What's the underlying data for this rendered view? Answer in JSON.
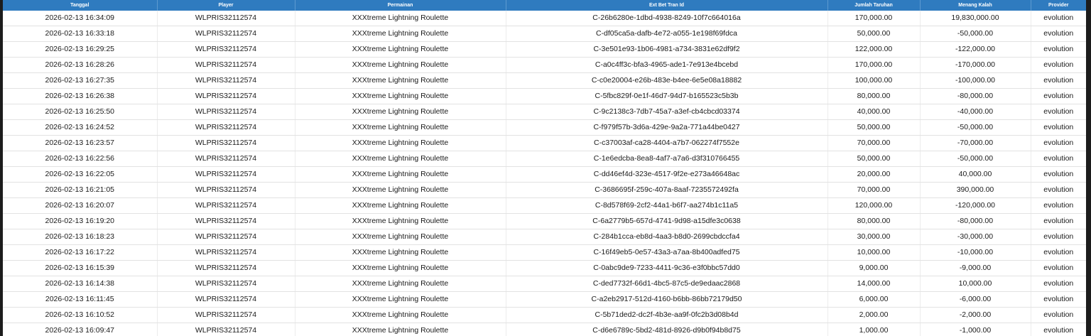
{
  "table": {
    "columns": [
      "Tanggal",
      "Player",
      "Permainan",
      "Ext Bet Tran Id",
      "Jumlah Taruhan",
      "Menang Kalah",
      "Provider"
    ],
    "rows": [
      [
        "2026-02-13 16:34:09",
        "WLPRIS32112574",
        "XXXtreme Lightning Roulette",
        "C-26b6280e-1dbd-4938-8249-10f7c664016a",
        "170,000.00",
        "19,830,000.00",
        "evolution"
      ],
      [
        "2026-02-13 16:33:18",
        "WLPRIS32112574",
        "XXXtreme Lightning Roulette",
        "C-df05ca5a-dafb-4e72-a055-1e198f69fdca",
        "50,000.00",
        "-50,000.00",
        "evolution"
      ],
      [
        "2026-02-13 16:29:25",
        "WLPRIS32112574",
        "XXXtreme Lightning Roulette",
        "C-3e501e93-1b06-4981-a734-3831e62df9f2",
        "122,000.00",
        "-122,000.00",
        "evolution"
      ],
      [
        "2026-02-13 16:28:26",
        "WLPRIS32112574",
        "XXXtreme Lightning Roulette",
        "C-a0c4ff3c-bfa3-4965-ade1-7e913e4bcebd",
        "170,000.00",
        "-170,000.00",
        "evolution"
      ],
      [
        "2026-02-13 16:27:35",
        "WLPRIS32112574",
        "XXXtreme Lightning Roulette",
        "C-c0e20004-e26b-483e-b4ee-6e5e08a18882",
        "100,000.00",
        "-100,000.00",
        "evolution"
      ],
      [
        "2026-02-13 16:26:38",
        "WLPRIS32112574",
        "XXXtreme Lightning Roulette",
        "C-5fbc829f-0e1f-46d7-94d7-b165523c5b3b",
        "80,000.00",
        "-80,000.00",
        "evolution"
      ],
      [
        "2026-02-13 16:25:50",
        "WLPRIS32112574",
        "XXXtreme Lightning Roulette",
        "C-9c2138c3-7db7-45a7-a3ef-cb4cbcd03374",
        "40,000.00",
        "-40,000.00",
        "evolution"
      ],
      [
        "2026-02-13 16:24:52",
        "WLPRIS32112574",
        "XXXtreme Lightning Roulette",
        "C-f979f57b-3d6a-429e-9a2a-771a44be0427",
        "50,000.00",
        "-50,000.00",
        "evolution"
      ],
      [
        "2026-02-13 16:23:57",
        "WLPRIS32112574",
        "XXXtreme Lightning Roulette",
        "C-c37003af-ca28-4404-a7b7-062274f7552e",
        "70,000.00",
        "-70,000.00",
        "evolution"
      ],
      [
        "2026-02-13 16:22:56",
        "WLPRIS32112574",
        "XXXtreme Lightning Roulette",
        "C-1e6edcba-8ea8-4af7-a7a6-d3f310766455",
        "50,000.00",
        "-50,000.00",
        "evolution"
      ],
      [
        "2026-02-13 16:22:05",
        "WLPRIS32112574",
        "XXXtreme Lightning Roulette",
        "C-dd46ef4d-323e-4517-9f2e-e273a46648ac",
        "20,000.00",
        "40,000.00",
        "evolution"
      ],
      [
        "2026-02-13 16:21:05",
        "WLPRIS32112574",
        "XXXtreme Lightning Roulette",
        "C-3686695f-259c-407a-8aaf-7235572492fa",
        "70,000.00",
        "390,000.00",
        "evolution"
      ],
      [
        "2026-02-13 16:20:07",
        "WLPRIS32112574",
        "XXXtreme Lightning Roulette",
        "C-8d578f69-2cf2-44a1-b6f7-aa274b1c11a5",
        "120,000.00",
        "-120,000.00",
        "evolution"
      ],
      [
        "2026-02-13 16:19:20",
        "WLPRIS32112574",
        "XXXtreme Lightning Roulette",
        "C-6a2779b5-657d-4741-9d98-a15dfe3c0638",
        "80,000.00",
        "-80,000.00",
        "evolution"
      ],
      [
        "2026-02-13 16:18:23",
        "WLPRIS32112574",
        "XXXtreme Lightning Roulette",
        "C-284b1cca-eb8d-4aa3-b8d0-2699cbdccfa4",
        "30,000.00",
        "-30,000.00",
        "evolution"
      ],
      [
        "2026-02-13 16:17:22",
        "WLPRIS32112574",
        "XXXtreme Lightning Roulette",
        "C-16f49eb5-0e57-43a3-a7aa-8b400adfed75",
        "10,000.00",
        "-10,000.00",
        "evolution"
      ],
      [
        "2026-02-13 16:15:39",
        "WLPRIS32112574",
        "XXXtreme Lightning Roulette",
        "C-0abc9de9-7233-4411-9c36-e3f0bbc57dd0",
        "9,000.00",
        "-9,000.00",
        "evolution"
      ],
      [
        "2026-02-13 16:14:38",
        "WLPRIS32112574",
        "XXXtreme Lightning Roulette",
        "C-ded7732f-66d1-4bc5-87c5-de9edaac2868",
        "14,000.00",
        "10,000.00",
        "evolution"
      ],
      [
        "2026-02-13 16:11:45",
        "WLPRIS32112574",
        "XXXtreme Lightning Roulette",
        "C-a2eb2917-512d-4160-b6bb-86bb72179d50",
        "6,000.00",
        "-6,000.00",
        "evolution"
      ],
      [
        "2026-02-13 16:10:52",
        "WLPRIS32112574",
        "XXXtreme Lightning Roulette",
        "C-5b71ded2-dc2f-4b3e-aa9f-0fc2b3d08b4d",
        "2,000.00",
        "-2,000.00",
        "evolution"
      ],
      [
        "2026-02-13 16:09:47",
        "WLPRIS32112574",
        "XXXtreme Lightning Roulette",
        "C-d6e6789c-5bd2-481d-8926-d9b0f94b8d75",
        "1,000.00",
        "-1,000.00",
        "evolution"
      ]
    ]
  },
  "colors": {
    "header_background": "#2f7bbf",
    "header_text": "#ffffff",
    "row_border": "#e2e2e2",
    "edge": "#1c1c1c"
  }
}
